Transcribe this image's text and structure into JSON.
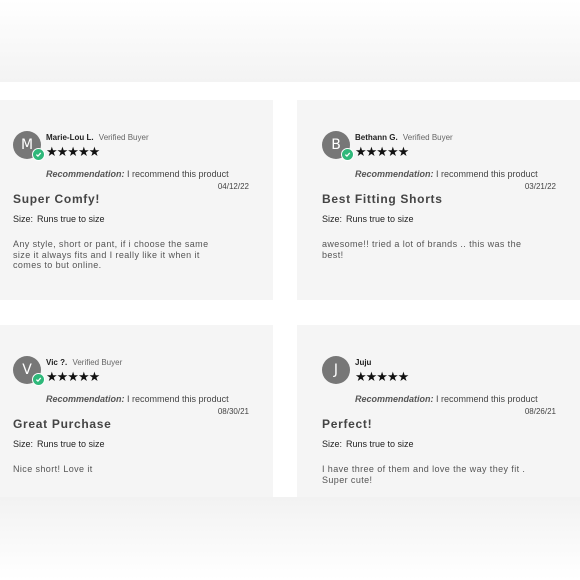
{
  "reviews": [
    {
      "initial": "M",
      "name": "Marie-Lou L.",
      "verified": "Verified Buyer",
      "stars": "★★★★★",
      "recommendation_label": "Recommendation:",
      "recommendation_text": "I recommend this product",
      "date": "04/12/22",
      "title": "Super Comfy!",
      "size_label": "Size:",
      "size_value": "Runs true to size",
      "body": "Any style, short or pant, if i choose the same size it always fits and I really like it when it comes to but online."
    },
    {
      "initial": "B",
      "name": "Bethann G.",
      "verified": "Verified Buyer",
      "stars": "★★★★★",
      "recommendation_label": "Recommendation:",
      "recommendation_text": "I recommend this product",
      "date": "03/21/22",
      "title": "Best Fitting Shorts",
      "size_label": "Size:",
      "size_value": "Runs true to size",
      "body": "awesome!! tried a lot of brands .. this was the best!"
    },
    {
      "initial": "V",
      "name": "Vic ?.",
      "verified": "Verified Buyer",
      "stars": "★★★★★",
      "recommendation_label": "Recommendation:",
      "recommendation_text": "I recommend this product",
      "date": "08/30/21",
      "title": "Great Purchase",
      "size_label": "Size:",
      "size_value": "Runs true to size",
      "body": "Nice short! Love it"
    },
    {
      "initial": "J",
      "name": "Juju",
      "verified": "",
      "stars": "★★★★★",
      "recommendation_label": "Recommendation:",
      "recommendation_text": "I recommend this product",
      "date": "08/26/21",
      "title": "Perfect!",
      "size_label": "Size:",
      "size_value": "Runs true to size",
      "body": "I have three of them and love the way they fit . Super cute!"
    }
  ],
  "colors": {
    "card_background": "#f5f5f5",
    "avatar": "#777777",
    "verified_badge": "#2fb87a",
    "stars": "#111111"
  }
}
